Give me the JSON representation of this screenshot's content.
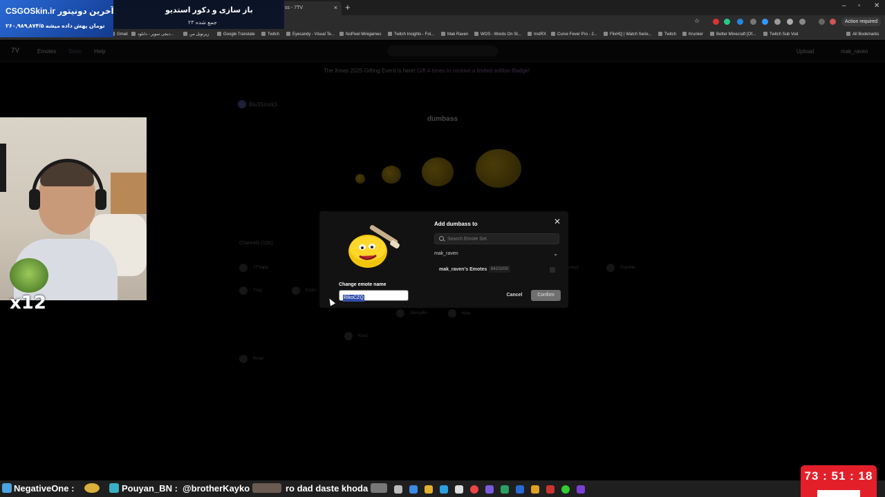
{
  "browser": {
    "active_tab_label": "ss - 7TV",
    "action_required": "Action required",
    "all_bookmarks": "All Bookmarks",
    "bookmarks": [
      "Gmail",
      "دیجی سوپر - دانلود...",
      "زیرنویل من",
      "Google Translate",
      "Twitch",
      "Eyecandy - Visual Te...",
      "NoPixel Minigames",
      "Twitch Insights - Fol...",
      "Mak Raven",
      "WOS - Words On St...",
      "InstRX",
      "Curve Fever Pro - 2...",
      "FlixHQ | Watch Serie...",
      "Twitch",
      "Krunker",
      "Better Minecraft [Of...",
      "Twitch Sub Vod"
    ]
  },
  "site": {
    "nav": {
      "emotes": "Emotes",
      "store": "Store",
      "help": "Help",
      "upload": "Upload",
      "user": "mak_raven"
    },
    "banner": {
      "text": "The Xmas 2025 Gifting Event is here!",
      "highlight": "Gift 4 times to receive a limited edition Badge!"
    },
    "owner": "Blu3Smok3",
    "emote_name": "dumbass",
    "channels_label": "Channels (12K)",
    "channels": [
      "7TVapp",
      "Troy",
      "Enzo",
      "JonnyBs",
      "ejay",
      "Knut",
      "Rinar",
      "Supelle",
      "ontyz"
    ]
  },
  "modal": {
    "title": "Add dumbass to",
    "search_placeholder": "Search Emote Set",
    "owner_select": "mak_raven",
    "sets": [
      {
        "name": "mak_raven's Emotes",
        "count": "842/1000"
      }
    ],
    "rename_label": "Change emote name",
    "rename_value": "RikoCZQ",
    "cancel": "Cancel",
    "confirm": "Confirm"
  },
  "overlay": {
    "sponsor_brand": "CSGOSkin.ir آخرین دونیتور:",
    "sponsor_sub": "۲۶۰,۹۸۹,۸۷۴/۵ تومان پهش داده میشه",
    "studio_title": "باز سازی و دکور استدیو",
    "studio_sub": "۲۳ جمع شده",
    "combo": "x12",
    "timer": "73 : 51 : 18"
  },
  "ticker": [
    {
      "name": "NegativeOne :",
      "message": ""
    },
    {
      "name": "Pouyan_BN :",
      "message": "@brotherKayko"
    },
    {
      "name": "",
      "message": "ro dad daste khoda"
    }
  ],
  "colors": {
    "accent_modal": "#121212",
    "confirm_bg": "#6f6f6f",
    "selection": "#2f4da8",
    "timer_bg": "#e3202a",
    "sponsor_bg": "#2a6ad6"
  }
}
